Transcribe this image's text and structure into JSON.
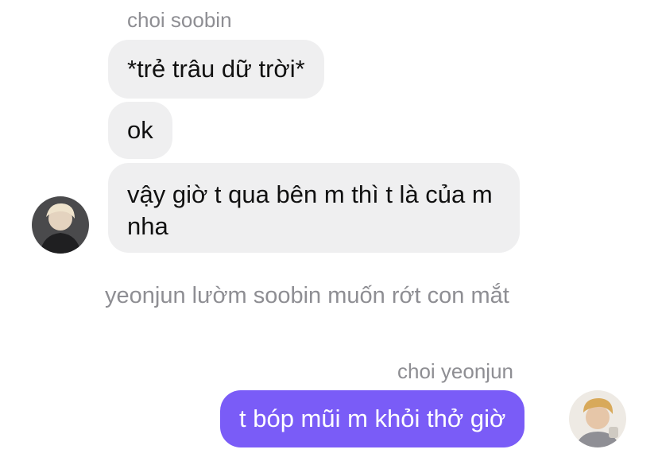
{
  "conversation": {
    "incoming": {
      "sender_name": "choi soobin",
      "messages": [
        "*trẻ trâu dữ trời*",
        "ok",
        "vậy giờ t qua bên m thì t là của m nha"
      ],
      "avatar_icon": "user-avatar-soobin"
    },
    "system_note": "yeonjun lườm soobin muốn rớt con mắt",
    "outgoing": {
      "sender_name": "choi yeonjun",
      "messages": [
        "t bóp mũi m khỏi thở giờ"
      ],
      "avatar_icon": "user-avatar-yeonjun"
    }
  },
  "colors": {
    "incoming_bubble": "#efeff0",
    "outgoing_bubble": "#7a5cf7",
    "meta_text": "#8e8e93"
  }
}
